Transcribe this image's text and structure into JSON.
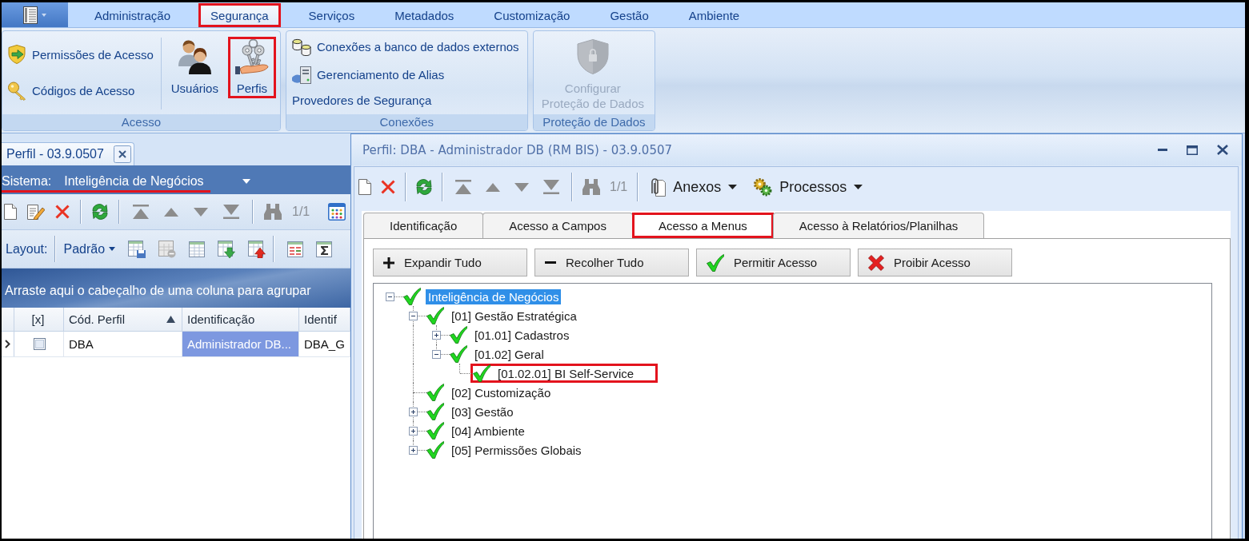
{
  "ribbon": {
    "tabs": [
      {
        "label": "Administração",
        "selected": false,
        "highlighted": false
      },
      {
        "label": "Segurança",
        "selected": true,
        "highlighted": true
      },
      {
        "label": "Serviços",
        "selected": false,
        "highlighted": false
      },
      {
        "label": "Metadados",
        "selected": false,
        "highlighted": false
      },
      {
        "label": "Customização",
        "selected": false,
        "highlighted": false
      },
      {
        "label": "Gestão",
        "selected": false,
        "highlighted": false
      },
      {
        "label": "Ambiente",
        "selected": false,
        "highlighted": false
      }
    ],
    "groups": [
      {
        "label": "Acesso",
        "items": [
          {
            "kind": "small",
            "label": "Permissões de Acesso",
            "disabled": false,
            "highlighted": false
          },
          {
            "kind": "small",
            "label": "Códigos de Acesso",
            "disabled": false,
            "highlighted": false
          },
          {
            "kind": "large",
            "label": "Usuários",
            "disabled": false,
            "highlighted": false
          },
          {
            "kind": "large",
            "label": "Perfis",
            "disabled": false,
            "highlighted": true
          }
        ]
      },
      {
        "label": "Conexões",
        "items": [
          {
            "kind": "small",
            "label": "Conexões a banco de dados externos",
            "disabled": false,
            "highlighted": false
          },
          {
            "kind": "small",
            "label": "Gerenciamento de Alias",
            "disabled": false,
            "highlighted": false
          },
          {
            "kind": "small",
            "label": "Provedores de Segurança",
            "disabled": false,
            "highlighted": false
          }
        ]
      },
      {
        "label": "Proteção de Dados",
        "items": [
          {
            "kind": "large",
            "label": "Configurar\nProteção de Dados",
            "disabled": true,
            "highlighted": false
          }
        ]
      }
    ]
  },
  "profiles": {
    "document_tab": {
      "label": "Perfil - 03.9.0507"
    },
    "system_filter": {
      "label": "Sistema:",
      "value": "Inteligência de Negócios",
      "highlighted": true
    },
    "toolbar": {
      "counter": "1/1"
    },
    "layout_bar": {
      "label": "Layout:",
      "preset": "Padrão"
    },
    "group_panel": {
      "hint": "Arraste aqui o cabeçalho de uma coluna para agrupar"
    },
    "grid": {
      "columns": [
        {
          "label": "[x]",
          "sorted": false
        },
        {
          "label": "Cód. Perfil",
          "sorted": true
        },
        {
          "label": "Identificação",
          "sorted": false
        },
        {
          "label": "Identif",
          "sorted": false
        }
      ],
      "rows": [
        {
          "current": true,
          "cells": [
            {
              "kind": "checkbox",
              "checked": false,
              "selected": false
            },
            {
              "kind": "text",
              "text": "DBA",
              "selected": false
            },
            {
              "kind": "text",
              "text": "Administrador DB...",
              "selected": true
            },
            {
              "kind": "text",
              "text": "DBA_G",
              "selected": false
            }
          ]
        }
      ]
    }
  },
  "dialog": {
    "title": "Perfil: DBA - Administrador DB (RM BIS) - 03.9.0507",
    "toolbar": {
      "counter": "1/1",
      "menus": [
        {
          "label": "Anexos"
        },
        {
          "label": "Processos"
        }
      ]
    },
    "tabs": [
      {
        "label": "Identificação",
        "selected": false,
        "highlighted": false
      },
      {
        "label": "Acesso a Campos",
        "selected": false,
        "highlighted": false
      },
      {
        "label": "Acesso a Menus",
        "selected": true,
        "highlighted": true
      },
      {
        "label": "Acesso à Relatórios/Planilhas",
        "selected": false,
        "highlighted": false
      }
    ],
    "actions": [
      {
        "kind": "expand",
        "label": "Expandir Tudo"
      },
      {
        "kind": "collapse",
        "label": "Recolher Tudo"
      },
      {
        "kind": "allow",
        "label": "Permitir Acesso"
      },
      {
        "kind": "deny",
        "label": "Proibir Acesso"
      }
    ],
    "tree": [
      {
        "label": "Inteligência de Negócios",
        "selected": true,
        "allowed": true,
        "highlighted": false,
        "expanded": true,
        "children": [
          {
            "label": "[01] Gestão Estratégica",
            "selected": false,
            "allowed": true,
            "highlighted": false,
            "expanded": true,
            "children": [
              {
                "label": "[01.01] Cadastros",
                "selected": false,
                "allowed": true,
                "highlighted": false,
                "expanded": false
              },
              {
                "label": "[01.02] Geral",
                "selected": false,
                "allowed": true,
                "highlighted": false,
                "expanded": true,
                "children": [
                  {
                    "label": "[01.02.01] BI Self-Service",
                    "selected": false,
                    "allowed": true,
                    "highlighted": true
                  }
                ]
              }
            ]
          },
          {
            "label": "[02] Customização",
            "selected": false,
            "allowed": true,
            "highlighted": false
          },
          {
            "label": "[03] Gestão",
            "selected": false,
            "allowed": true,
            "highlighted": false,
            "expanded": false
          },
          {
            "label": "[04] Ambiente",
            "selected": false,
            "allowed": true,
            "highlighted": false,
            "expanded": false
          },
          {
            "label": "[05] Permissões Globais",
            "selected": false,
            "allowed": true,
            "highlighted": false,
            "expanded": false
          }
        ]
      }
    ]
  }
}
